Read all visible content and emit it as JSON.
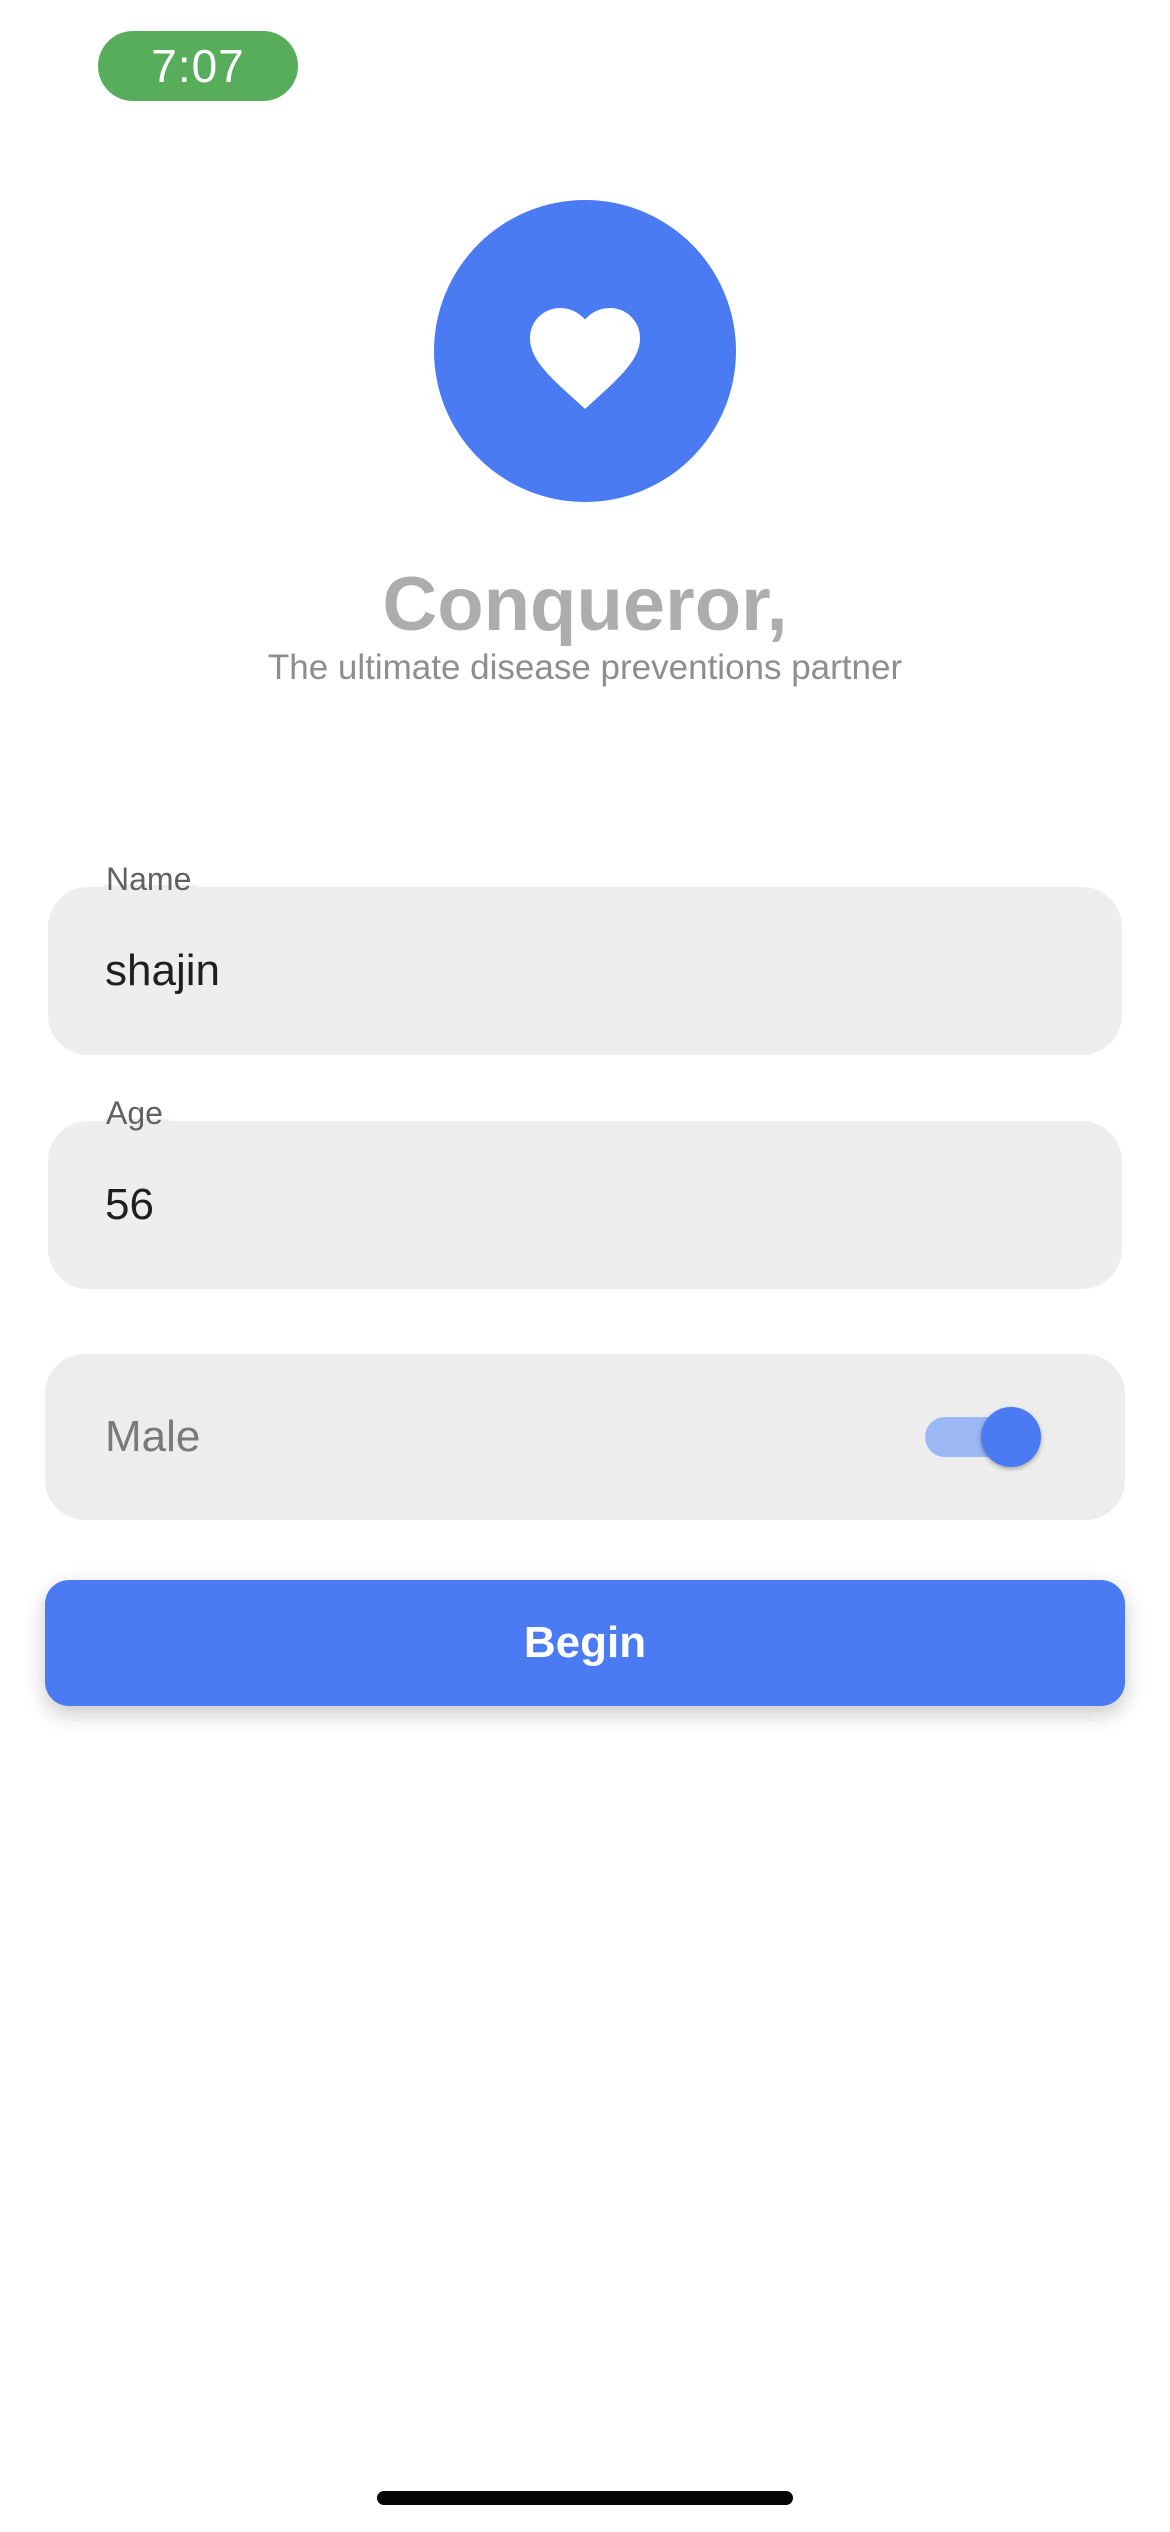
{
  "status_bar": {
    "time": "7:07",
    "time_pill_color": "#58ad5a"
  },
  "logo": {
    "icon": "heart-icon",
    "background_color": "#4a7bf2"
  },
  "header": {
    "title": "Conqueror,",
    "subtitle": "The ultimate disease preventions partner"
  },
  "form": {
    "name_field": {
      "label": "Name",
      "value": "shajin"
    },
    "age_field": {
      "label": "Age",
      "value": "56"
    },
    "gender_toggle": {
      "label": "Male",
      "checked": true
    },
    "begin_label": "Begin"
  },
  "colors": {
    "accent": "#4a7bf2",
    "field_background": "#eeeeee"
  }
}
